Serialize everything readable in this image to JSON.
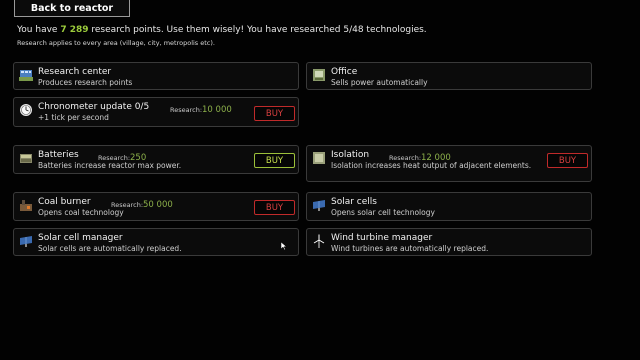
{
  "back_button": "Back to reactor",
  "intro": {
    "prefix": "You have ",
    "points": "7 289",
    "suffix": " research points. Use them wisely! You have researched 5/48 technologies."
  },
  "note": "Research applies to every area (village, city, metropolis etc).",
  "research_label": "Research:",
  "cards": {
    "research_center": {
      "title": "Research center",
      "desc": "Produces research points",
      "icon": "research-center-icon"
    },
    "office": {
      "title": "Office",
      "desc": "Sells power automatically",
      "icon": "office-icon"
    },
    "chronometer": {
      "title": "Chronometer update 0/5",
      "desc": "+1 tick per second",
      "cost": "10 000",
      "buy": "BUY",
      "icon": "chronometer-icon"
    },
    "batteries": {
      "title": "Batteries",
      "desc": "Batteries increase reactor max power.",
      "cost": "250",
      "buy": "BUY",
      "icon": "battery-icon"
    },
    "isolation": {
      "title": "Isolation",
      "desc": "Isolation increases heat output of adjacent elements.",
      "cost": "12 000",
      "buy": "BUY",
      "icon": "isolation-icon"
    },
    "coal_burner": {
      "title": "Coal burner",
      "desc": "Opens coal technology",
      "cost": "50 000",
      "buy": "BUY",
      "icon": "coal-burner-icon"
    },
    "solar_cells": {
      "title": "Solar cells",
      "desc": "Opens solar cell technology",
      "icon": "solar-cell-icon"
    },
    "solar_manager": {
      "title": "Solar cell manager",
      "desc": "Solar cells are automatically replaced.",
      "icon": "solar-cell-icon"
    },
    "wind_manager": {
      "title": "Wind turbine manager",
      "desc": "Wind turbines are automatically replaced.",
      "icon": "wind-turbine-icon"
    }
  },
  "colors": {
    "points": "#9ccc3c",
    "cost": "#8cb04a",
    "buy_disabled": "#d84040",
    "buy_enabled": "#c7e04c"
  }
}
